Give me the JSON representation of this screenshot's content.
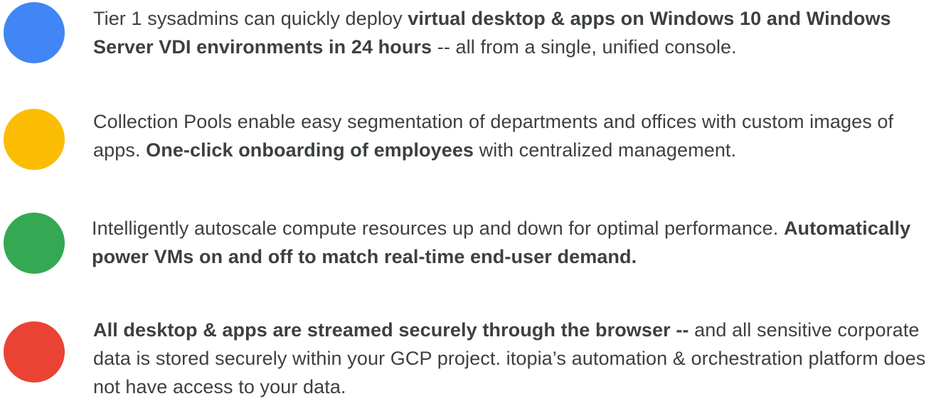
{
  "colors": {
    "blue": "#4285f4",
    "yellow": "#fbbc04",
    "green": "#34a853",
    "red": "#ea4335",
    "text": "#3c4043"
  },
  "items": [
    {
      "dot_color": "#4285f4",
      "parts": [
        {
          "text": "Tier 1 sysadmins can quickly deploy ",
          "bold": false
        },
        {
          "text": "virtual desktop & apps on Windows 10 and Windows Server VDI environments in 24 hours",
          "bold": true
        },
        {
          "text": " -- all from a single, unified console.",
          "bold": false
        }
      ]
    },
    {
      "dot_color": "#fbbc04",
      "parts": [
        {
          "text": "Collection Pools enable easy segmentation of departments and offices with custom images of apps. ",
          "bold": false
        },
        {
          "text": "One-click onboarding of employees",
          "bold": true
        },
        {
          "text": " with centralized management.",
          "bold": false
        }
      ]
    },
    {
      "dot_color": "#34a853",
      "parts": [
        {
          "text": "Intelligently autoscale compute resources up and down for optimal performance. ",
          "bold": false
        },
        {
          "text": "Automatically power VMs on and off to match real-time end-user demand.",
          "bold": true
        }
      ]
    },
    {
      "dot_color": "#ea4335",
      "parts": [
        {
          "text": "All desktop & apps are streamed securely through the browser --",
          "bold": true
        },
        {
          "text": " and all sensitive corporate data is stored securely within your GCP project. itopia’s automation & orchestration platform does not have access to your data.",
          "bold": false
        }
      ]
    }
  ]
}
